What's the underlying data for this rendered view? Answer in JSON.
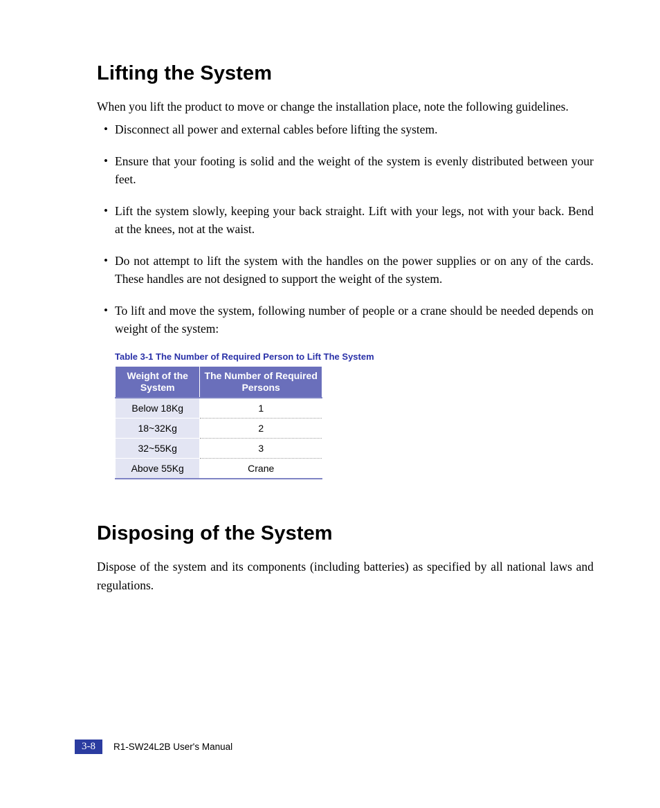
{
  "section1": {
    "title": "Lifting the System",
    "intro": "When you lift the product to move or change the installation place, note the following guidelines.",
    "bullets": [
      "Disconnect all power and external cables before lifting the system.",
      "Ensure that your footing is solid and the weight of the system is evenly distributed between your feet.",
      "Lift the system slowly, keeping your back straight. Lift with your legs, not with your back. Bend at the knees, not at the waist.",
      "Do not attempt to lift the system with the handles on the power supplies or on any of the cards. These handles are not designed to support the weight of the system.",
      "To lift and move the system, following number of people or a crane should be needed depends on weight of the system:"
    ]
  },
  "table": {
    "caption": "Table 3-1    The Number of Required Person to Lift The System",
    "headers": {
      "col1": "Weight of the System",
      "col2": "The Number of Required Persons"
    },
    "rows": [
      {
        "w": "Below    18Kg",
        "n": "1"
      },
      {
        "w": "18~32Kg",
        "n": "2"
      },
      {
        "w": "32~55Kg",
        "n": "3"
      },
      {
        "w": "Above 55Kg",
        "n": "Crane"
      }
    ]
  },
  "section2": {
    "title": "Disposing of the System",
    "body": "Dispose of the system and its components (including batteries) as specified by all national laws and regulations."
  },
  "footer": {
    "page": "3-8",
    "manual": "R1-SW24L2B    User's Manual"
  }
}
